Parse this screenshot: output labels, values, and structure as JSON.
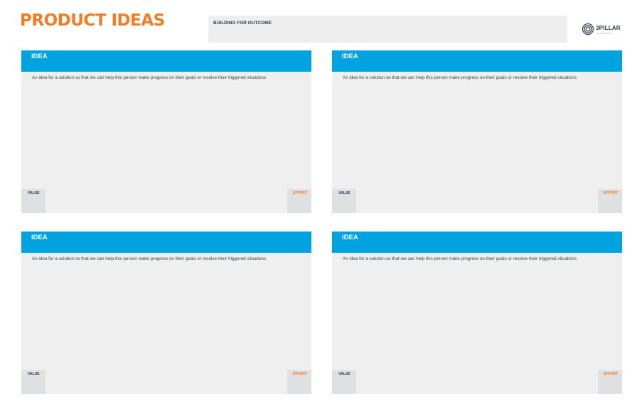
{
  "page": {
    "title": "PRODUCT IDEAS",
    "outcome_label": "BUILDING FOR OUTCOME"
  },
  "logo": {
    "name": "3PILLAR",
    "subtitle": "GLOBAL"
  },
  "cards": [
    {
      "title": "IDEA",
      "description": "An idea for a solution so that we can help this person make progress on their goals or resolve their triggered situations",
      "value_label": "VALUE",
      "effort_label": "EFFORT"
    },
    {
      "title": "IDEA",
      "description": "An idea for a solution so that we can help this person make progress on their goals or resolve their triggered situations",
      "value_label": "VALUE",
      "effort_label": "EFFORT"
    },
    {
      "title": "IDEA",
      "description": "An idea for a solution so that we can help this person make progress on their goals or resolve their triggered situations",
      "value_label": "VALUE",
      "effort_label": "EFFORT"
    },
    {
      "title": "IDEA",
      "description": "An idea for a solution so that we can help this person make progress on their goals or resolve their triggered situations",
      "value_label": "VALUE",
      "effort_label": "EFFORT"
    }
  ],
  "colors": {
    "title_orange": "#f47b20",
    "header_blue": "#00a3e0",
    "card_bg": "#efefef",
    "corner_box": "#dfe0e2",
    "text_dark": "#2f3a45"
  }
}
